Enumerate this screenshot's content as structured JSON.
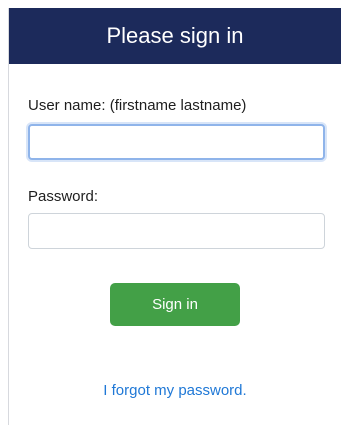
{
  "header": {
    "title": "Please sign in"
  },
  "form": {
    "username_label": "User name: (firstname lastname)",
    "username_value": "",
    "password_label": "Password:",
    "password_value": "",
    "signin_label": "Sign in",
    "forgot_link": "I forgot my password."
  },
  "colors": {
    "header_bg": "#1c2a5b",
    "button_bg": "#43a047",
    "link": "#1f78d6",
    "focus_ring": "#8fb4ea"
  }
}
